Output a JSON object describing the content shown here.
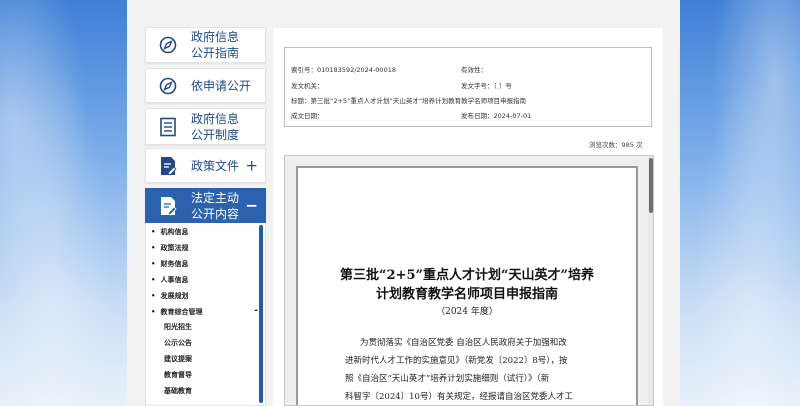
{
  "sidebar": {
    "items": [
      {
        "label_line1": "政府信息",
        "label_line2": "公开指南",
        "icon": "compass-icon"
      },
      {
        "label_line1": "依申请公开",
        "label_line2": "",
        "icon": "compass-icon"
      },
      {
        "label_line1": "政府信息",
        "label_line2": "公开制度",
        "icon": "document-list-icon"
      },
      {
        "label_line1": "政策文件",
        "label_line2": "",
        "icon": "edit-document-icon",
        "toggle": "+"
      },
      {
        "label_line1": "法定主动",
        "label_line2": "公开内容",
        "icon": "edit-document-icon",
        "toggle": "−"
      }
    ],
    "submenu": [
      "机构信息",
      "政策法规",
      "财务信息",
      "人事信息",
      "发展规划",
      "教育综合管理"
    ],
    "submenu_toggle": "-",
    "subsubmenu": [
      "阳光招生",
      "公示公告",
      "建议提案",
      "教育督导",
      "基础教育"
    ]
  },
  "meta": {
    "index_label": "索引号：010183592/2024-00018",
    "validity_label": "有效性：",
    "issuer_label": "发文机关：",
    "doc_number_label": "发文字号：〔 〕号",
    "title_label": "标题：第三批“2+5”重点人才计划“天山英才”培养计划教育教学名师项目申报指南",
    "created_label": "成文日期：",
    "published_label": "发布日期：2024-07-01"
  },
  "views": {
    "text": "浏览次数：985 次"
  },
  "document": {
    "title_line1": "第三批“2+5”重点人才计划“天山英才”培养",
    "title_line2": "计划教育教学名师项目申报指南",
    "year": "（2024 年度）",
    "body": [
      "为贯彻落实《自治区党委 自治区人民政府关于加强和改",
      "进新时代人才工作的实施意见》（新党发〔2022〕8号），按",
      "照《自治区“天山英才”培养计划实施细则（试行）》（新",
      "科智字〔2024〕10号）有关规定，经报请自治区党委人才工"
    ]
  },
  "colors": {
    "accent": "#2a62ad",
    "link": "#1f4a8a"
  }
}
